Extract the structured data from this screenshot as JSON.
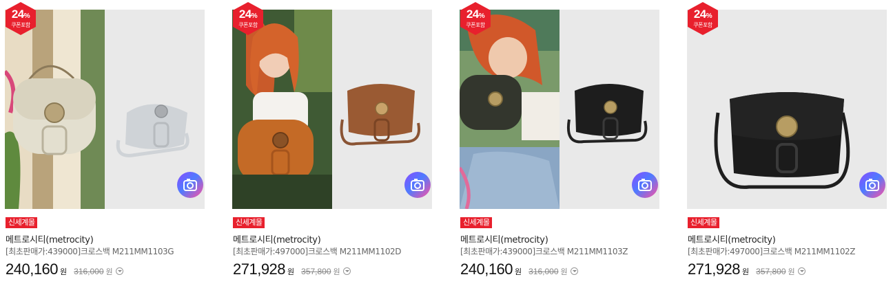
{
  "products": [
    {
      "badge_pct": "24",
      "badge_pct_unit": "%",
      "badge_sub": "쿠폰포함",
      "tag": "신세계몰",
      "brand": "메트로시티(metrocity)",
      "name": "[최초판매가:439000]크로스백 M211MM1103G",
      "price": "240,160",
      "price_unit": "원",
      "original_price": "316,000",
      "original_unit": "원",
      "bag_color": "#cfd3d7",
      "model_bag_color": "#e3dfcf"
    },
    {
      "badge_pct": "24",
      "badge_pct_unit": "%",
      "badge_sub": "쿠폰포함",
      "tag": "신세계몰",
      "brand": "메트로시티(metrocity)",
      "name": "[최초판매가:497000]크로스백 M211MM1102D",
      "price": "271,928",
      "price_unit": "원",
      "original_price": "357,800",
      "original_unit": "원",
      "bag_color": "#9a5a33",
      "model_bag_color": "#c46a26"
    },
    {
      "badge_pct": "24",
      "badge_pct_unit": "%",
      "badge_sub": "쿠폰포함",
      "tag": "신세계몰",
      "brand": "메트로시티(metrocity)",
      "name": "[최초판매가:439000]크로스백 M211MM1103Z",
      "price": "240,160",
      "price_unit": "원",
      "original_price": "316,000",
      "original_unit": "원",
      "bag_color": "#1d1d1d",
      "model_bag_color": "#33362d"
    },
    {
      "badge_pct": "24",
      "badge_pct_unit": "%",
      "badge_sub": "쿠폰포함",
      "tag": "신세계몰",
      "brand": "메트로시티(metrocity)",
      "name": "[최초판매가:497000]크로스백 M211MM1102Z",
      "price": "271,928",
      "price_unit": "원",
      "original_price": "357,800",
      "original_unit": "원",
      "bag_color": "#1b1b1b",
      "model_bag_color": "#1b1b1b"
    }
  ],
  "icons": {
    "camera": "camera-search-icon",
    "info": "chevron-down-info-icon"
  }
}
